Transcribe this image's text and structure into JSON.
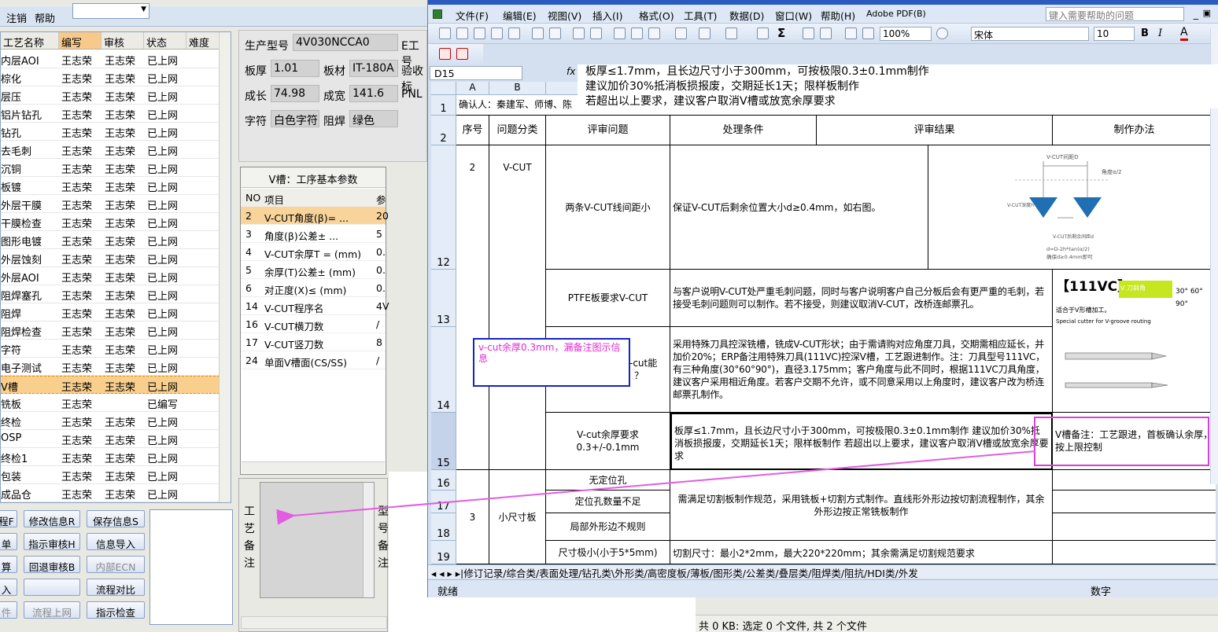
{
  "left_app": {
    "menu": {
      "logout": "注销",
      "help": "帮助"
    },
    "grid": {
      "columns": [
        "工艺名称",
        "编写",
        "审核",
        "状态",
        "难度"
      ],
      "rows": [
        {
          "name": "内层AOI",
          "writer": "王志荣",
          "reviewer": "王志荣",
          "status": "已上网"
        },
        {
          "name": "棕化",
          "writer": "王志荣",
          "reviewer": "王志荣",
          "status": "已上网"
        },
        {
          "name": "层压",
          "writer": "王志荣",
          "reviewer": "王志荣",
          "status": "已上网"
        },
        {
          "name": "铝片钻孔",
          "writer": "王志荣",
          "reviewer": "王志荣",
          "status": "已上网"
        },
        {
          "name": "钻孔",
          "writer": "王志荣",
          "reviewer": "王志荣",
          "status": "已上网"
        },
        {
          "name": "去毛刺",
          "writer": "王志荣",
          "reviewer": "王志荣",
          "status": "已上网"
        },
        {
          "name": "沉铜",
          "writer": "王志荣",
          "reviewer": "王志荣",
          "status": "已上网"
        },
        {
          "name": "板镀",
          "writer": "王志荣",
          "reviewer": "王志荣",
          "status": "已上网"
        },
        {
          "name": "外层干膜",
          "writer": "王志荣",
          "reviewer": "王志荣",
          "status": "已上网"
        },
        {
          "name": "干膜检查",
          "writer": "王志荣",
          "reviewer": "王志荣",
          "status": "已上网"
        },
        {
          "name": "图形电镀",
          "writer": "王志荣",
          "reviewer": "王志荣",
          "status": "已上网"
        },
        {
          "name": "外层蚀刻",
          "writer": "王志荣",
          "reviewer": "王志荣",
          "status": "已上网"
        },
        {
          "name": "外层AOI",
          "writer": "王志荣",
          "reviewer": "王志荣",
          "status": "已上网"
        },
        {
          "name": "阻焊塞孔",
          "writer": "王志荣",
          "reviewer": "王志荣",
          "status": "已上网"
        },
        {
          "name": "阻焊",
          "writer": "王志荣",
          "reviewer": "王志荣",
          "status": "已上网"
        },
        {
          "name": "阻焊检查",
          "writer": "王志荣",
          "reviewer": "王志荣",
          "status": "已上网"
        },
        {
          "name": "字符",
          "writer": "王志荣",
          "reviewer": "王志荣",
          "status": "已上网"
        },
        {
          "name": "电子测试",
          "writer": "王志荣",
          "reviewer": "王志荣",
          "status": "已上网"
        },
        {
          "name": "V槽",
          "writer": "王志荣",
          "reviewer": "王志荣",
          "status": "已上网"
        },
        {
          "name": "铣板",
          "writer": "王志荣",
          "reviewer": "",
          "status": "已编写"
        },
        {
          "name": "终检",
          "writer": "王志荣",
          "reviewer": "王志荣",
          "status": "已上网"
        },
        {
          "name": "OSP",
          "writer": "王志荣",
          "reviewer": "王志荣",
          "status": "已上网"
        },
        {
          "name": "终检1",
          "writer": "王志荣",
          "reviewer": "王志荣",
          "status": "已上网"
        },
        {
          "name": "包装",
          "writer": "王志荣",
          "reviewer": "王志荣",
          "status": "已上网"
        },
        {
          "name": "成品仓",
          "writer": "王志荣",
          "reviewer": "王志荣",
          "status": "已上网"
        }
      ]
    },
    "buttons": {
      "b1": "程F",
      "b2": "修改信息R",
      "b3": "保存信息S",
      "b4": "单",
      "b5": "指示审核H",
      "b6": "信息导入",
      "b7": "算",
      "b8": "回退审核B",
      "b9": "内部ECN",
      "b10": "入",
      "b11": "",
      "b12": "流程对比",
      "b13": "件",
      "b14": "流程上网",
      "b15": "指示检查"
    }
  },
  "middle": {
    "fields": {
      "model_label": "生产型号",
      "model_value": "4V030NCCA0",
      "model_extra": "E工号",
      "thick_label": "板厚",
      "thick_value": "1.01",
      "material_label": "板材",
      "material_value": "IT-180A",
      "accept_label": "验收标",
      "len_label": "成长",
      "len_value": "74.98",
      "wid_label": "成宽",
      "wid_value": "141.6",
      "pnl_label": "PNL",
      "char_label": "字符",
      "char_value": "白色字符",
      "mask_label": "阻焊",
      "mask_value": "绿色"
    },
    "vgrid": {
      "title": "V槽：工序基本参数",
      "col_no": "NO",
      "col_item": "项目",
      "col_param": "参",
      "rows": [
        {
          "no": "2",
          "item": "V-CUT角度(β)=  ...",
          "val": "20"
        },
        {
          "no": "3",
          "item": "角度(β)公差±  ...",
          "val": "5"
        },
        {
          "no": "4",
          "item": "V-CUT余厚T =  (mm)",
          "val": "0."
        },
        {
          "no": "5",
          "item": "余厚(T)公差±  (mm)",
          "val": "0."
        },
        {
          "no": "6",
          "item": "对正度(X)≤ (mm)",
          "val": "0."
        },
        {
          "no": "14",
          "item": "V-CUT程序名",
          "val": "4V"
        },
        {
          "no": "16",
          "item": "V-CUT横刀数",
          "val": "/"
        },
        {
          "no": "17",
          "item": "V-CUT竖刀数",
          "val": "8"
        },
        {
          "no": "24",
          "item": "单面V槽面(CS/SS)",
          "val": "/"
        }
      ]
    },
    "memo_label": [
      "工",
      "艺",
      "备",
      "注"
    ],
    "memo_label2": [
      "型",
      "号",
      "备",
      "注"
    ]
  },
  "bottom_status": "共 0 KB: 选定 0 个文件, 共 2 个文件",
  "excel": {
    "menu": [
      "文件(F)",
      "编辑(E)",
      "视图(V)",
      "插入(I)",
      "格式(O)",
      "工具(T)",
      "数据(D)",
      "窗口(W)",
      "帮助(H)",
      "Adobe PDF(B)"
    ],
    "help_placeholder": "键入需要帮助的问题",
    "zoom": "100%",
    "font": "宋体",
    "font_size": "10",
    "name_box": "D15",
    "fx": "fx",
    "formula_lines": [
      "板厚≤1.7mm，且长边尺寸小于300mm，可按极限0.3±0.1mm制作",
      "建议加价30%抵消板损报废，交期延长1天；限样板制作",
      "若超出以上要求，建议客户取消V槽或放宽余厚要求"
    ],
    "col_headers": [
      "A",
      "B"
    ],
    "row1_text": "确认人：秦建军、师博、陈",
    "headers": {
      "seq": "序号",
      "category": "问题分类",
      "issue": "评审问题",
      "condition": "处理条件",
      "result": "评审结果",
      "method": "制作办法"
    },
    "rows": {
      "r12_seq": "2",
      "r12_cat": "V-CUT",
      "r12_issue": "两条V-CUT线间距小",
      "r12_cond": "保证V-CUT后剩余位置大小d≥0.4mm，如右图。",
      "diagram": {
        "t1": "V-CUT间距D",
        "t2": "角度α/2",
        "t3": "V-CUT深度h",
        "t4": "V-CUT后剩余间距d",
        "t5": "d=D-2h*tan(α/2)",
        "t6": "确保d≥0.4mm即可"
      },
      "r13_issue": "PTFE板要求V-CUT",
      "r13_cond": "与客户说明V-CUT处严重毛刺问题，同时与客户说明客户自己分板后会有更严重的毛刺，若接受毛刺问题则可以制作。若不接受，则建议取消V-CUT，改桥连邮票孔。",
      "tool": {
        "title": "【111VC】",
        "badge": "V 刀斜角",
        "angles": "30° 60° 90°",
        "line1": "适合于V形槽加工。",
        "line2": "Special cutter for V-groove routing"
      },
      "r14_issue": "-cut能",
      "r14_issue2": "？",
      "r14_cond": "采用特殊刀具控深铣槽，铣成V-CUT形状；由于需请购对应角度刀具，交期需相应延长，并加价20%；ERP备注用特殊刀具(111VC)控深V槽，工艺跟进制作。注：刀具型号111VC，有三种角度(30°60°90°)，直径3.175mm；客户角度与此不同时，根据111VC刀具角度，建议客户采用相近角度。若客户交期不允许，或不同意采用以上角度时，建议客户改为桥连邮票孔制作。",
      "r15_issue": "V-cut余厚要求0.3+/-0.1mm",
      "r15_cond": "板厚≤1.7mm，且长边尺寸小于300mm，可按极限0.3±0.1mm制作 建议加价30%抵消板损报废，交期延长1天；限样板制作 若超出以上要求，建议客户取消V槽或放宽余厚要求",
      "r15_method": "V槽备注：工艺跟进，首板确认余厚，按上限控制",
      "r16_issue": "无定位孔",
      "r17_issue": "定位孔数量不足",
      "r18_issue": "局部外形边不规则",
      "r16_seq": "3",
      "r16_cat": "小尺寸板",
      "r16_cond": "需满足切割板制作规范，采用铣板+切割方式制作。直线形外形边按切割流程制作，其余外形边按正常铣板制作",
      "r19_issue": "尺寸极小(小于5*5mm)",
      "r19_cond": "切割尺寸：最小2*2mm，最大220*220mm；其余需满足切割规范要求"
    },
    "row_numbers": [
      "1",
      "2",
      "12",
      "13",
      "14",
      "15",
      "16",
      "17",
      "18",
      "19"
    ],
    "tabs": "◂ ◂ ▸ ▸|修订记录/综合类/表面处理/钻孔类\\外形类/高密度板/薄板/图形类/公差类/叠层类/阻焊类/阻抗/HDI类/外发",
    "status_left": "就绪",
    "status_right": "数字"
  },
  "annotation": "v-cut余厚0.3mm，漏备注图示信息"
}
